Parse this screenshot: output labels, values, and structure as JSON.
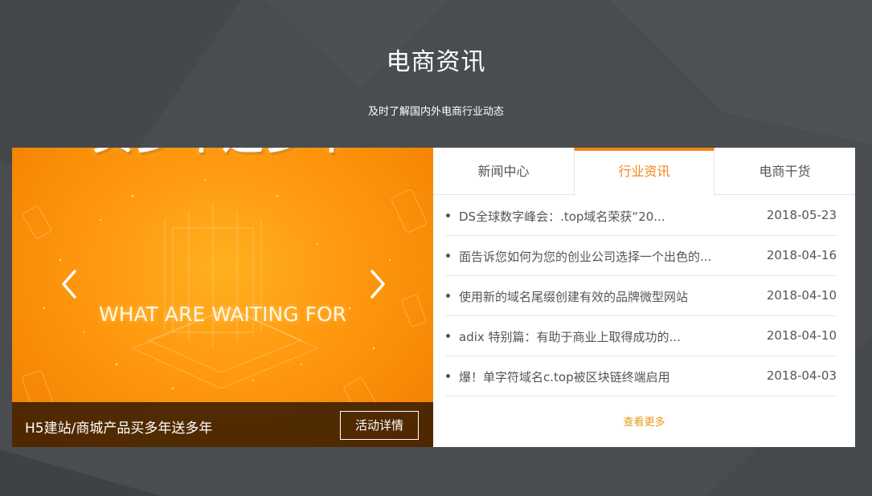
{
  "section": {
    "title": "电商资讯",
    "subtitle": "及时了解国内外电商行业动态"
  },
  "banner": {
    "headline": "买多年送多年",
    "subheadline": "WHAT ARE WAITING FOR",
    "caption": "H5建站/商城产品买多年送多年",
    "detail_button": "活动详情",
    "prev_icon": "chevron-left-icon",
    "next_icon": "chevron-right-icon"
  },
  "tabs": [
    {
      "label": "新闻中心",
      "active": false
    },
    {
      "label": "行业资讯",
      "active": true
    },
    {
      "label": "电商干货",
      "active": false
    }
  ],
  "news": [
    {
      "title": "DS全球数字峰会：.top域名荣获“20...",
      "date": "2018-05-23"
    },
    {
      "title": "面告诉您如何为您的创业公司选择一个出色的...",
      "date": "2018-04-16"
    },
    {
      "title": "使用新的域名尾缀创建有效的品牌微型网站",
      "date": "2018-04-10"
    },
    {
      "title": "adix 特别篇：有助于商业上取得成功的...",
      "date": "2018-04-10"
    },
    {
      "title": "爆！单字符域名c.top被区块链终端启用",
      "date": "2018-04-03"
    }
  ],
  "more_label": "查看更多",
  "colors": {
    "accent": "#f08519",
    "more_link": "#e59a1d",
    "background": "#4a4d50",
    "banner": "#f78a06"
  }
}
